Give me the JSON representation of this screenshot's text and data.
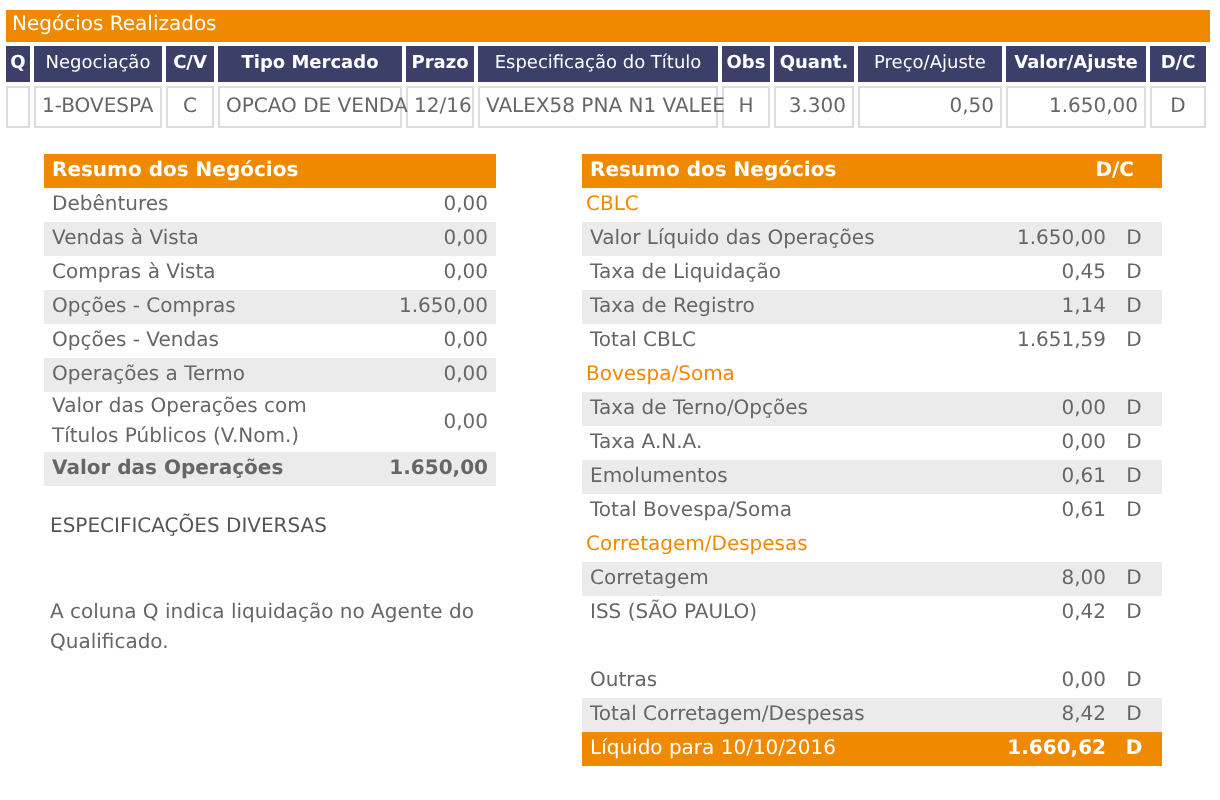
{
  "trades": {
    "title": "Negócios Realizados",
    "columns": [
      {
        "label": "Q",
        "bold": true
      },
      {
        "label": "Negociação",
        "bold": false
      },
      {
        "label": "C/V",
        "bold": true
      },
      {
        "label": "Tipo Mercado",
        "bold": true
      },
      {
        "label": "Prazo",
        "bold": true
      },
      {
        "label": "Especificação do Título",
        "bold": false
      },
      {
        "label": "Obs",
        "bold": true
      },
      {
        "label": "Quant.",
        "bold": true
      },
      {
        "label": "Preço/Ajuste",
        "bold": false
      },
      {
        "label": "Valor/Ajuste",
        "bold": true
      },
      {
        "label": "D/C",
        "bold": true
      }
    ],
    "rows": [
      [
        "",
        "1-BOVESPA",
        "C",
        "OPCAO DE VENDA",
        "12/16",
        "VALEX58 PNA N1 VALEE",
        "H",
        "3.300",
        "0,50",
        "1.650,00",
        "D"
      ]
    ]
  },
  "summary": {
    "title": "Resumo dos Negócios",
    "rows": [
      {
        "label": "Debêntures",
        "value": "0,00",
        "shaded": false,
        "bold": false
      },
      {
        "label": "Vendas à Vista",
        "value": "0,00",
        "shaded": true,
        "bold": false
      },
      {
        "label": "Compras à Vista",
        "value": "0,00",
        "shaded": false,
        "bold": false
      },
      {
        "label": "Opções - Compras",
        "value": "1.650,00",
        "shaded": true,
        "bold": false
      },
      {
        "label": "Opções - Vendas",
        "value": "0,00",
        "shaded": false,
        "bold": false
      },
      {
        "label": "Operações a Termo",
        "value": "0,00",
        "shaded": true,
        "bold": false
      },
      {
        "label": "Valor das Operações com Títulos Públicos (V.Nom.)",
        "value": "0,00",
        "shaded": false,
        "bold": false
      },
      {
        "label": "Valor das Operações",
        "value": "1.650,00",
        "shaded": true,
        "bold": true
      }
    ]
  },
  "specs": {
    "title": "ESPECIFICAÇÕES DIVERSAS",
    "note": "A coluna Q indica liquidação no Agente do Qualificado."
  },
  "settlement": {
    "title": "Resumo dos Negócios",
    "dc_header": "D/C",
    "rows": [
      {
        "kind": "section",
        "label": "CBLC"
      },
      {
        "kind": "row",
        "label": "Valor Líquido das Operações",
        "value": "1.650,00",
        "dc": "D",
        "shaded": true
      },
      {
        "kind": "row",
        "label": "Taxa de Liquidação",
        "value": "0,45",
        "dc": "D",
        "shaded": false
      },
      {
        "kind": "row",
        "label": "Taxa de Registro",
        "value": "1,14",
        "dc": "D",
        "shaded": true
      },
      {
        "kind": "row",
        "label": "Total CBLC",
        "value": "1.651,59",
        "dc": "D",
        "shaded": false
      },
      {
        "kind": "section",
        "label": "Bovespa/Soma"
      },
      {
        "kind": "row",
        "label": "Taxa de Terno/Opções",
        "value": "0,00",
        "dc": "D",
        "shaded": true
      },
      {
        "kind": "row",
        "label": "Taxa A.N.A.",
        "value": "0,00",
        "dc": "D",
        "shaded": false
      },
      {
        "kind": "row",
        "label": "Emolumentos",
        "value": "0,61",
        "dc": "D",
        "shaded": true
      },
      {
        "kind": "row",
        "label": "Total Bovespa/Soma",
        "value": "0,61",
        "dc": "D",
        "shaded": false
      },
      {
        "kind": "section",
        "label": "Corretagem/Despesas"
      },
      {
        "kind": "row",
        "label": "Corretagem",
        "value": "8,00",
        "dc": "D",
        "shaded": true
      },
      {
        "kind": "row",
        "label": "ISS (SÃO PAULO)",
        "value": "0,42",
        "dc": "D",
        "shaded": false
      },
      {
        "kind": "blank"
      },
      {
        "kind": "row",
        "label": "Outras",
        "value": "0,00",
        "dc": "D",
        "shaded": false
      },
      {
        "kind": "row",
        "label": "Total Corretagem/Despesas",
        "value": "8,42",
        "dc": "D",
        "shaded": true
      },
      {
        "kind": "total",
        "label": "Líquido para 10/10/2016",
        "value": "1.660,62",
        "dc": "D"
      }
    ]
  }
}
